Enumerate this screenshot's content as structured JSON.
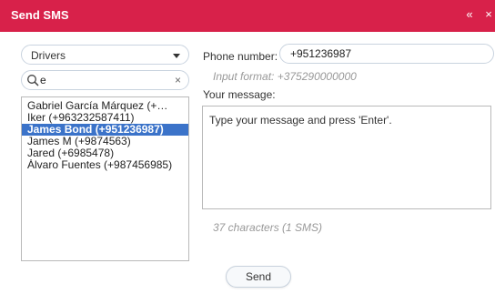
{
  "window": {
    "title": "Send SMS",
    "collapse_glyph": "«",
    "close_glyph": "×",
    "accent": "#d8214a"
  },
  "left": {
    "group_select": {
      "value": "Drivers"
    },
    "search": {
      "value": "e",
      "clear_glyph": "×"
    },
    "contacts": [
      {
        "label": "Gabriel García Márquez (+…",
        "selected": false
      },
      {
        "label": "Iker (+963232587411)",
        "selected": false
      },
      {
        "label": "James Bond (+951236987)",
        "selected": true
      },
      {
        "label": "James M (+9874563)",
        "selected": false
      },
      {
        "label": "Jared (+6985478)",
        "selected": false
      },
      {
        "label": "Álvaro Fuentes (+987456985)",
        "selected": false
      }
    ],
    "selection_color": "#3b73c9"
  },
  "right": {
    "phone_label": "Phone number:",
    "phone_value": "+951236987",
    "phone_hint": "Input format: +375290000000",
    "message_label": "Your message:",
    "message_text": "Type your message and press 'Enter'.",
    "counter": "37 characters (1 SMS)"
  },
  "footer": {
    "send_label": "Send"
  }
}
